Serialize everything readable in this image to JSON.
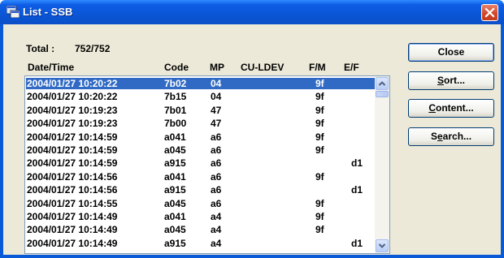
{
  "window": {
    "title": "List - SSB",
    "icons": {
      "app": "app-window-icon",
      "close": "close-icon"
    }
  },
  "summary": {
    "total_label": "Total :",
    "total_value": "752/752"
  },
  "columns": [
    "Date/Time",
    "Code",
    "MP",
    "CU-LDEV",
    "F/M",
    "E/F"
  ],
  "rows": [
    {
      "datetime": "2004/01/27 10:20:22",
      "code": "7b02",
      "mp": "04",
      "culdev": "",
      "fm": "9f",
      "ef": "",
      "selected": true
    },
    {
      "datetime": "2004/01/27 10:20:22",
      "code": "7b15",
      "mp": "04",
      "culdev": "",
      "fm": "9f",
      "ef": ""
    },
    {
      "datetime": "2004/01/27 10:19:23",
      "code": "7b01",
      "mp": "47",
      "culdev": "",
      "fm": "9f",
      "ef": ""
    },
    {
      "datetime": "2004/01/27 10:19:23",
      "code": "7b00",
      "mp": "47",
      "culdev": "",
      "fm": "9f",
      "ef": ""
    },
    {
      "datetime": "2004/01/27 10:14:59",
      "code": "a041",
      "mp": "a6",
      "culdev": "",
      "fm": "9f",
      "ef": ""
    },
    {
      "datetime": "2004/01/27 10:14:59",
      "code": "a045",
      "mp": "a6",
      "culdev": "",
      "fm": "9f",
      "ef": ""
    },
    {
      "datetime": "2004/01/27 10:14:59",
      "code": "a915",
      "mp": "a6",
      "culdev": "",
      "fm": "",
      "ef": "d1"
    },
    {
      "datetime": "2004/01/27 10:14:56",
      "code": "a041",
      "mp": "a6",
      "culdev": "",
      "fm": "9f",
      "ef": ""
    },
    {
      "datetime": "2004/01/27 10:14:56",
      "code": "a915",
      "mp": "a6",
      "culdev": "",
      "fm": "",
      "ef": "d1"
    },
    {
      "datetime": "2004/01/27 10:14:55",
      "code": "a045",
      "mp": "a6",
      "culdev": "",
      "fm": "9f",
      "ef": ""
    },
    {
      "datetime": "2004/01/27 10:14:49",
      "code": "a041",
      "mp": "a4",
      "culdev": "",
      "fm": "9f",
      "ef": ""
    },
    {
      "datetime": "2004/01/27 10:14:49",
      "code": "a045",
      "mp": "a4",
      "culdev": "",
      "fm": "9f",
      "ef": ""
    },
    {
      "datetime": "2004/01/27 10:14:49",
      "code": "a915",
      "mp": "a4",
      "culdev": "",
      "fm": "",
      "ef": "d1"
    }
  ],
  "buttons": {
    "close": {
      "label": "Close",
      "mnemonic": ""
    },
    "sort": {
      "label": "Sort...",
      "mnemonic": "S"
    },
    "content": {
      "label": "Content...",
      "mnemonic": "C"
    },
    "search": {
      "label": "Search...",
      "mnemonic": "e"
    }
  },
  "scrollbar": {
    "icons": {
      "up": "scroll-up-arrow-icon",
      "down": "scroll-down-arrow-icon"
    }
  },
  "colors": {
    "titlebar": "#0a56d6",
    "face": "#ece9d8",
    "selection": "#316ac5",
    "close_button": "#d2482a"
  }
}
